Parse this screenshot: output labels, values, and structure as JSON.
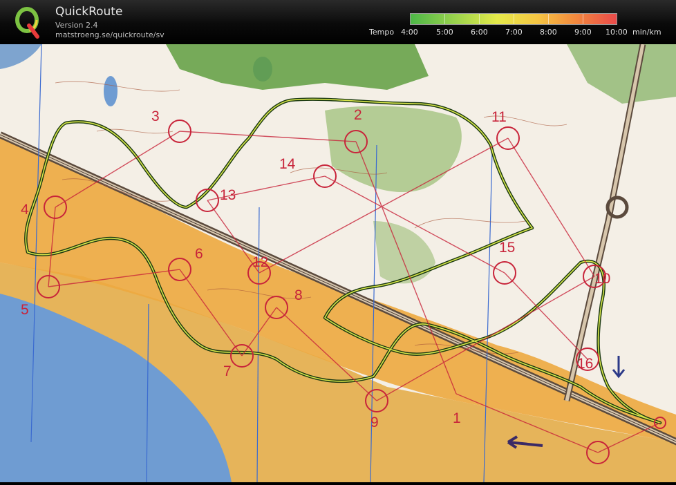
{
  "app": {
    "title": "QuickRoute",
    "version": "Version 2.4",
    "url": "matstroeng.se/quickroute/sv"
  },
  "legend": {
    "label": "Tempo",
    "ticks": [
      "4:00",
      "5:00",
      "6:00",
      "7:00",
      "8:00",
      "9:00",
      "10:00"
    ],
    "unit": "min/km",
    "colors": [
      "#4db748",
      "#9bd34d",
      "#e5ea4a",
      "#f5c443",
      "#f2893e",
      "#ea4a4a"
    ]
  },
  "map": {
    "controls": [
      "1",
      "2",
      "3",
      "4",
      "5",
      "6",
      "7",
      "8",
      "9",
      "10",
      "11",
      "12",
      "13",
      "14",
      "15",
      "16"
    ],
    "colors": {
      "control": "#c8243a",
      "route": "#d8e64a",
      "water": "#6e9bd0",
      "forest": "#f2f0ea",
      "green": "#5a9a3a",
      "open": "#e9a340",
      "sand": "#e3b255"
    }
  }
}
